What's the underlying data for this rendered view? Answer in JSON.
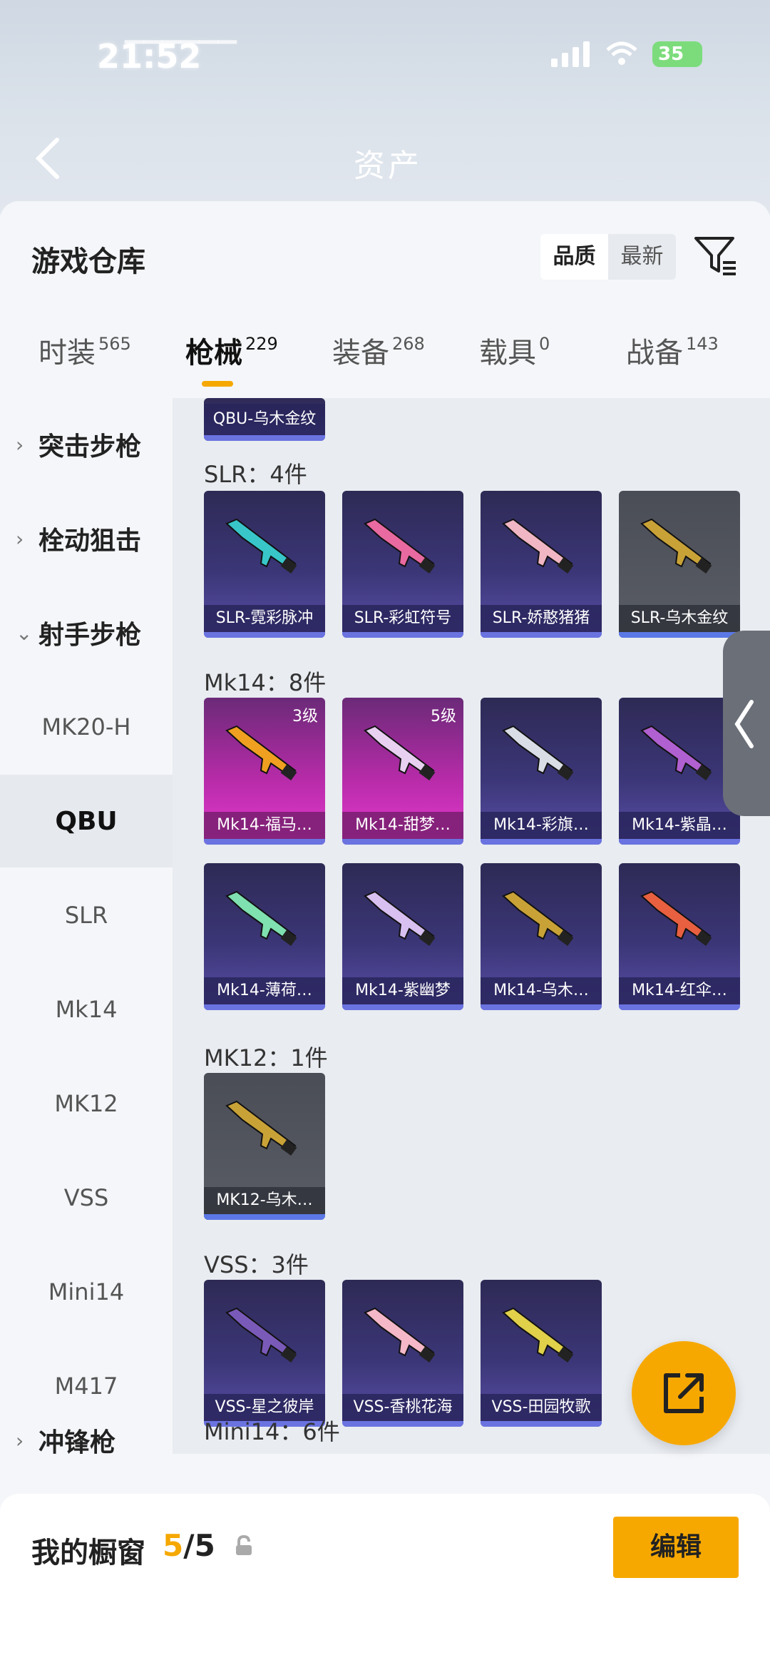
{
  "status": {
    "time": "21:52",
    "battery": "35"
  },
  "header": {
    "title": "资产"
  },
  "sheet": {
    "title": "游戏仓库",
    "sort": {
      "quality": "品质",
      "latest": "最新"
    }
  },
  "tabs": [
    {
      "label": "时装",
      "count": "565"
    },
    {
      "label": "枪械",
      "count": "229"
    },
    {
      "label": "装备",
      "count": "268"
    },
    {
      "label": "载具",
      "count": "0"
    },
    {
      "label": "战备",
      "count": "143"
    }
  ],
  "sidebar": {
    "categories": [
      {
        "label": "突击步枪"
      },
      {
        "label": "栓动狙击"
      },
      {
        "label": "射手步枪"
      },
      {
        "label": "冲锋枪"
      }
    ],
    "subs": [
      {
        "label": "MK20-H"
      },
      {
        "label": "QBU"
      },
      {
        "label": "SLR"
      },
      {
        "label": "Mk14"
      },
      {
        "label": "MK12"
      },
      {
        "label": "VSS"
      },
      {
        "label": "Mini14"
      },
      {
        "label": "M417"
      }
    ]
  },
  "groups": {
    "qbu_tail": {
      "label": "QBU-乌木金纹"
    },
    "slr": {
      "title": "SLR：4件",
      "items": [
        {
          "name": "SLR-霓彩脉冲",
          "color": "#38c6c9"
        },
        {
          "name": "SLR-彩虹符号",
          "color": "#e86aa0"
        },
        {
          "name": "SLR-娇憨猪猪",
          "color": "#f0b6c4"
        },
        {
          "name": "SLR-乌木金纹",
          "color": "#c9a237"
        }
      ]
    },
    "mk14": {
      "title": "Mk14：8件",
      "items": [
        {
          "name": "Mk14-福马…",
          "level": "3级",
          "color": "#f0a020"
        },
        {
          "name": "Mk14-甜梦…",
          "level": "5级",
          "color": "#e8d0f0"
        },
        {
          "name": "Mk14-彩旗…",
          "color": "#d8dde6"
        },
        {
          "name": "Mk14-紫晶…",
          "color": "#b060d0"
        },
        {
          "name": "Mk14-薄荷…",
          "color": "#7fe0b0"
        },
        {
          "name": "Mk14-紫幽梦",
          "color": "#d8c0f0"
        },
        {
          "name": "Mk14-乌木…",
          "color": "#c9a237"
        },
        {
          "name": "Mk14-红伞…",
          "color": "#e86040"
        }
      ]
    },
    "mk12": {
      "title": "MK12：1件",
      "items": [
        {
          "name": "MK12-乌木…",
          "color": "#c9a237"
        }
      ]
    },
    "vss": {
      "title": "VSS：3件",
      "items": [
        {
          "name": "VSS-星之彼岸",
          "color": "#7a5ab8"
        },
        {
          "name": "VSS-香桃花海",
          "color": "#f4b8c8"
        },
        {
          "name": "VSS-田园牧歌",
          "color": "#e0d04a"
        }
      ]
    },
    "mini14": {
      "title": "Mini14：6件"
    }
  },
  "bottom": {
    "title": "我的橱窗",
    "current": "5",
    "total": "/5",
    "edit": "编辑"
  }
}
